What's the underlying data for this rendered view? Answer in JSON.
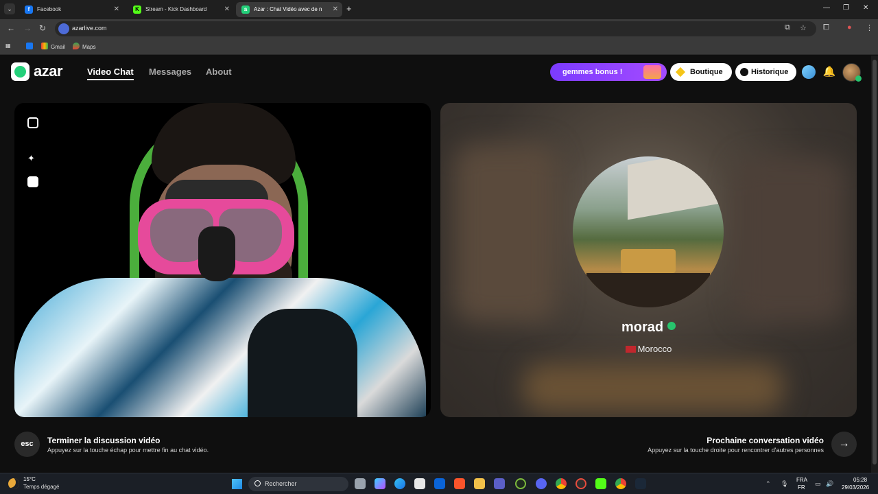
{
  "browser": {
    "tabs": [
      {
        "label": "Facebook",
        "favicon": "facebook-icon",
        "active": false
      },
      {
        "label": "Stream - Kick Dashboard",
        "favicon": "kick-icon",
        "active": false
      },
      {
        "label": "Azar : Chat Vidéo avec de n",
        "favicon": "azar-icon",
        "active": true
      }
    ],
    "url": "azarlive.com",
    "bookmarks": [
      {
        "label": "",
        "icon": "facebook-icon"
      },
      {
        "label": "Gmail",
        "icon": "gmail-icon"
      },
      {
        "label": "Maps",
        "icon": "maps-icon"
      }
    ]
  },
  "app": {
    "logo_text": "azar",
    "nav": [
      {
        "label": "Video Chat",
        "active": true
      },
      {
        "label": "Messages",
        "active": false
      },
      {
        "label": "About",
        "active": false
      }
    ],
    "gems_label": "gemmes bonus !",
    "boutique_label": "Boutique",
    "historique_label": "Historique",
    "partner": {
      "name": "morad",
      "country": "Morocco"
    },
    "end_hint": {
      "key": "esc",
      "title": "Terminer la discussion vidéo",
      "subtitle": "Appuyez sur la touche échap pour mettre fin au chat vidéo."
    },
    "next_hint": {
      "title": "Prochaine conversation vidéo",
      "subtitle": "Appuyez sur la touche droite pour rencontrer d'autres personnes",
      "arrow": "→"
    }
  },
  "taskbar": {
    "weather_temp": "15°C",
    "weather_desc": "Temps dégagé",
    "search_placeholder": "Rechercher",
    "lang_top": "FRA",
    "lang_bottom": "FR",
    "time": "05:28",
    "date": "29/03/2026"
  },
  "colors": {
    "accent_green": "#24d07a",
    "gems_purple": "#8a3dff",
    "background": "#0f0f0f"
  }
}
